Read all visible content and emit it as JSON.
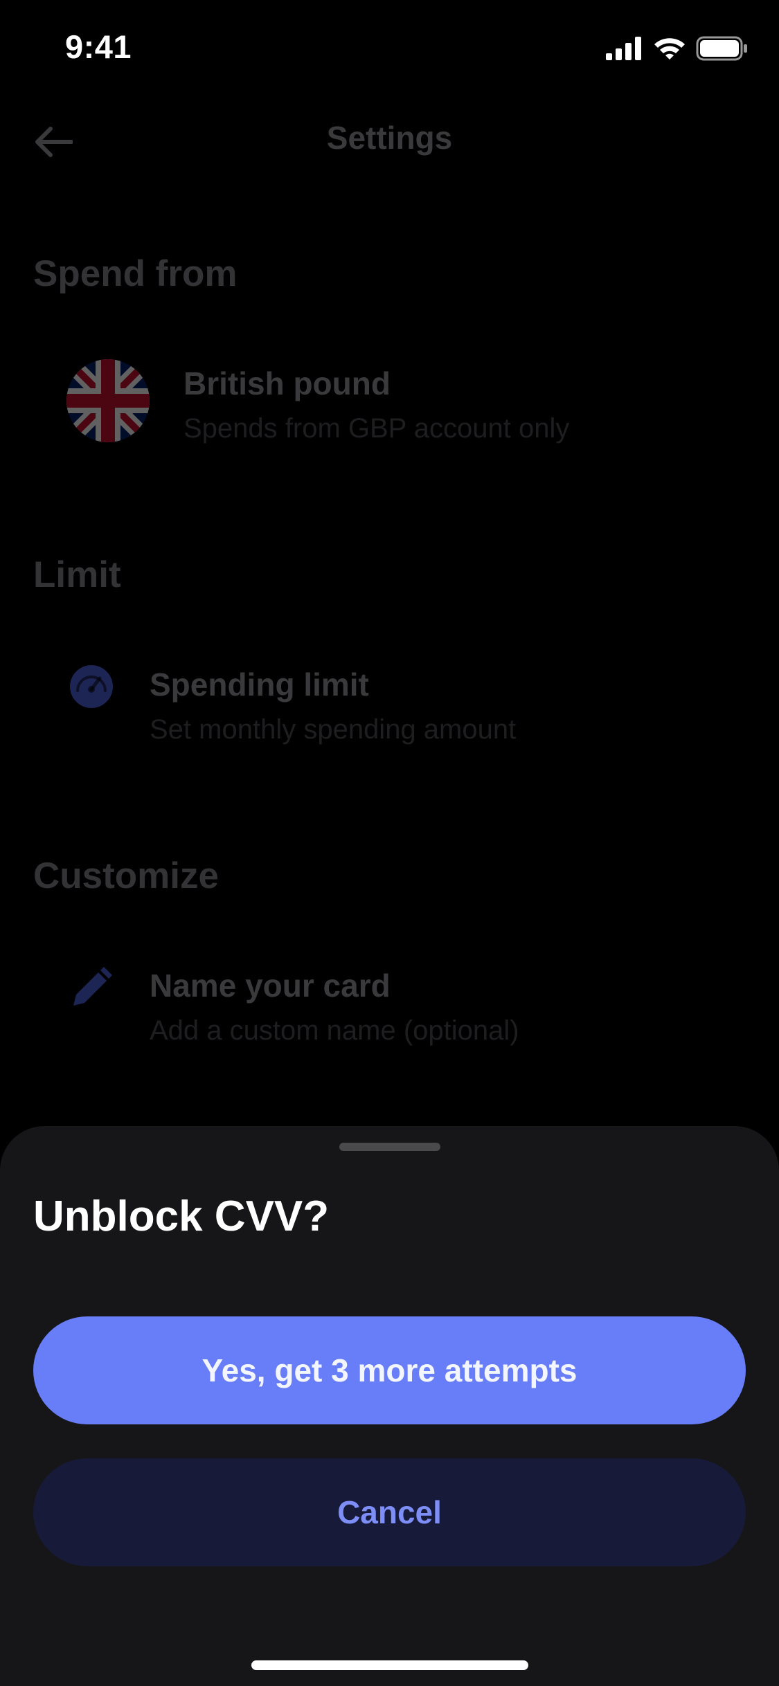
{
  "status_bar": {
    "time": "9:41",
    "icons": [
      "cellular-signal-icon",
      "wifi-icon",
      "battery-icon"
    ]
  },
  "settings_page": {
    "nav": {
      "title": "Settings",
      "back_icon": "arrow-left-icon"
    },
    "sections": [
      {
        "title": "Spend from",
        "item": {
          "icon": "uk-flag-icon",
          "title": "British pound",
          "subtitle": "Spends from GBP account only"
        }
      },
      {
        "title": "Limit",
        "item": {
          "icon": "speedometer-icon",
          "title": "Spending limit",
          "subtitle": "Set monthly spending amount"
        }
      },
      {
        "title": "Customize",
        "item": {
          "icon": "pencil-icon",
          "title": "Name your card",
          "subtitle": "Add a custom name (optional)"
        }
      }
    ]
  },
  "sheet": {
    "title": "Unblock CVV?",
    "primary_label": "Yes, get 3 more attempts",
    "secondary_label": "Cancel"
  },
  "colors": {
    "accent": "#687df8",
    "secondary_button_bg": "#181a3a",
    "sheet_bg": "#161618",
    "icon_dim_blue": "#1d2555"
  }
}
